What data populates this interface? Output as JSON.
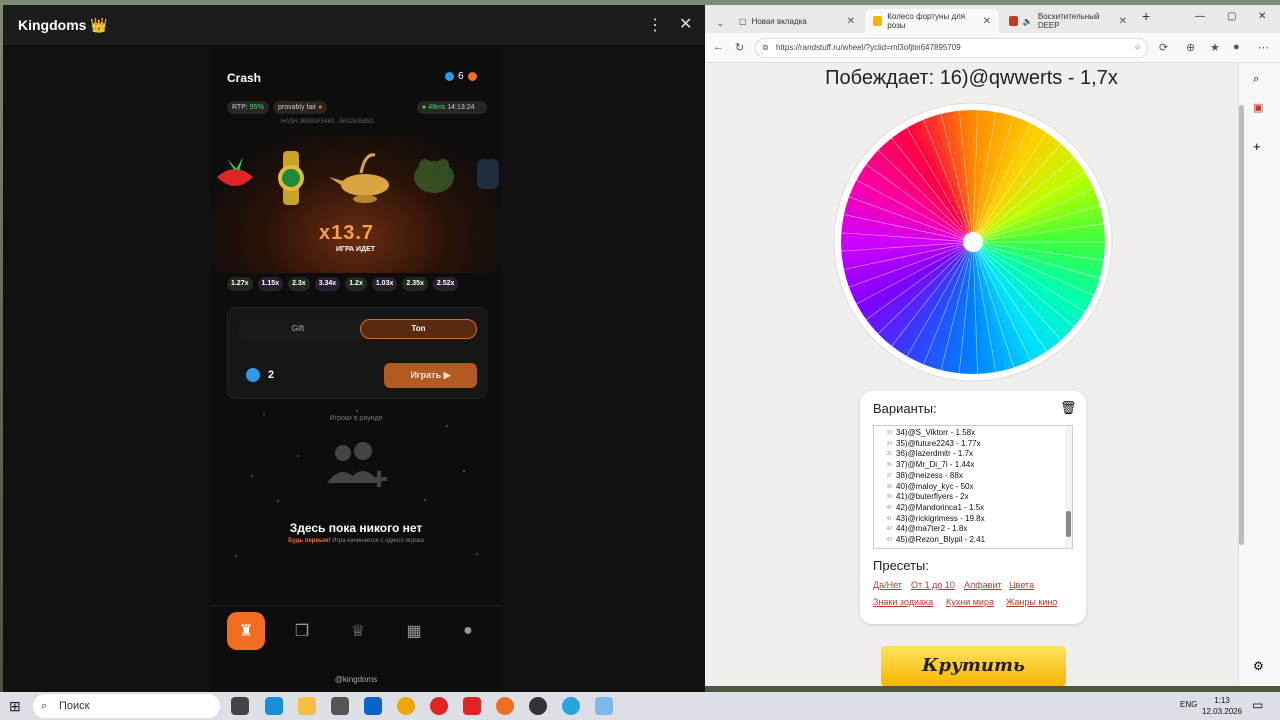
{
  "telegram": {
    "title": "Kingdoms 👑",
    "menu_icon": "⋮",
    "close_icon": "✕"
  },
  "app": {
    "title": "Crash",
    "balance": "6",
    "rtp_label": "RTP:",
    "rtp_value": "95%",
    "fair_label": "provably fair",
    "ping": "48ms",
    "time": "14:13:24",
    "hash": "HASH   3B88AF5463...56S2835852",
    "multiplier": "x13.7",
    "state": "ИГРА ИДЕТ",
    "history": [
      "1.27x",
      "1.15x",
      "2.3x",
      "3.34x",
      "1.2x",
      "1.03x",
      "2.35x",
      "2.52x"
    ],
    "tab_gift": "Gift",
    "tab_ton": "Ton",
    "amount": "2",
    "play_label": "Играть ▶",
    "players_label": "Игроки в раунде",
    "empty_title": "Здесь пока никого нет",
    "empty_sub_bold": "Будь первым!",
    "empty_sub": "Игра начинается с одного игрока",
    "footer": "@kingdoms"
  },
  "browser": {
    "tabs": [
      {
        "label": "Новая вкладка"
      },
      {
        "label": "Колесо фортуны для розы"
      },
      {
        "label": "Восхитительный DEEP"
      }
    ],
    "url": "https://randstuff.ru/wheel/?yclid=ml3ofjtin647895709",
    "winner": "Побеждает: 16)@qwwerts - 1,7x",
    "variants_title": "Варианты:",
    "variants": [
      {
        "n": "33",
        "t": "34)@S_Viktorr - 1.58x"
      },
      {
        "n": "34",
        "t": "35)@future2243 - 1.77x"
      },
      {
        "n": "35",
        "t": "36)@lazerdmitr - 1.7x"
      },
      {
        "n": "36",
        "t": "37)@Mr_Di_7i - 1.44x"
      },
      {
        "n": "37",
        "t": "38)@neizess - 88x"
      },
      {
        "n": "38",
        "t": "40)@maloy_kyc - 50x"
      },
      {
        "n": "39",
        "t": "41)@buterflyers - 2x"
      },
      {
        "n": "40",
        "t": "42)@Mandorinca1 - 1.5x"
      },
      {
        "n": "41",
        "t": "43)@rickigrimess - 19.8x"
      },
      {
        "n": "42",
        "t": "44)@ma7ter2 - 1.8x"
      },
      {
        "n": "43",
        "t": "45)@Rezon_Blypil - 2.41"
      }
    ],
    "presets_title": "Пресеты:",
    "presets": [
      "Да/Нет",
      "От 1 до 10",
      "Алфавит",
      "Цвета",
      "Знаки зодиака",
      "Кухни мира",
      "Жанры кино"
    ],
    "spin_label": "Крутить"
  },
  "taskbar": {
    "search": "Поиск",
    "lang": "ENG",
    "time": "1:13",
    "date": "12.03.2026"
  }
}
